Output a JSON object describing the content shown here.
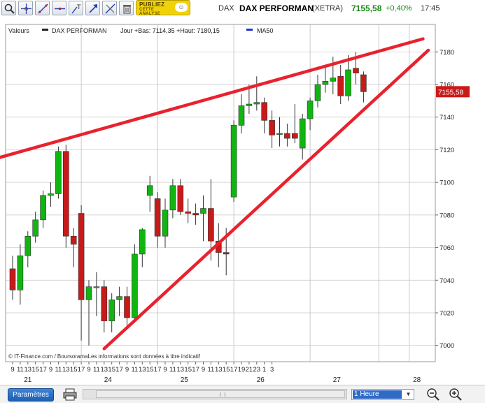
{
  "header": {
    "ad_line1": "PUBLIEZ",
    "ad_line2": "CETTE",
    "ad_line3": "ANALYSE",
    "ad_bubble": "☺",
    "ticker_prefix": "DAX",
    "ticker_name": "DAX PERFORMAN",
    "market": "(XETRA)",
    "price": "7155,58",
    "change": "+0,40%",
    "time": "17:45"
  },
  "toolbar_icons": [
    "zoom-icon",
    "crosshair-icon",
    "trendline-icon",
    "horizontal-line-icon",
    "text-icon",
    "arrow-icon",
    "erase-line-icon",
    "trash-icon"
  ],
  "legend": {
    "values_label": "Valeurs",
    "series_label": "DAX PERFORMAN",
    "stats": "Jour +Bas: 7114,35 +Haut: 7180,15",
    "ma_label": "MA50"
  },
  "footer_credit": "© IT-Finance.com / BoursoramaLes informations sont données à titre indicatif",
  "colors": {
    "up": "#11b511",
    "down": "#c91a1a",
    "trendline": "#e8222e",
    "grid": "#c8c8c8",
    "price_tag": "#c91a1a",
    "ma": "#1f34c9",
    "positive_text": "#1a8a1a"
  },
  "chart_data": {
    "type": "candlestick",
    "timeframe": "1 Heure",
    "ylim": [
      6995,
      7190
    ],
    "y_ticks": [
      7000,
      7020,
      7040,
      7060,
      7080,
      7100,
      7120,
      7140,
      7160,
      7180
    ],
    "x_hour_labels": [
      "9",
      "11",
      "13",
      "15",
      "17",
      "9",
      "11",
      "13",
      "15",
      "17",
      "9",
      "11",
      "13",
      "15",
      "17",
      "9",
      "11",
      "13",
      "15",
      "17",
      "9",
      "11",
      "13",
      "15",
      "17",
      "9",
      "11",
      "13",
      "15",
      "17",
      "19",
      "21",
      "23",
      "1",
      "3"
    ],
    "x_date_labels": [
      {
        "label": "21",
        "slot": 2
      },
      {
        "label": "24",
        "slot": 12.5
      },
      {
        "label": "25",
        "slot": 22.5
      },
      {
        "label": "26",
        "slot": 32.5
      },
      {
        "label": "27",
        "slot": 42.5
      },
      {
        "label": "28",
        "slot": 53
      }
    ],
    "day_separators": [
      9,
      19,
      29,
      39,
      48,
      52
    ],
    "last_price": 7155.58,
    "last_price_label": "7155,58",
    "candles": [
      {
        "slot": 0,
        "o": 7047,
        "h": 7055,
        "l": 7028,
        "c": 7034
      },
      {
        "slot": 1,
        "o": 7034,
        "h": 7062,
        "l": 7025,
        "c": 7055
      },
      {
        "slot": 2,
        "o": 7055,
        "h": 7070,
        "l": 7048,
        "c": 7067
      },
      {
        "slot": 3,
        "o": 7067,
        "h": 7082,
        "l": 7063,
        "c": 7077
      },
      {
        "slot": 4,
        "o": 7077,
        "h": 7095,
        "l": 7072,
        "c": 7092
      },
      {
        "slot": 5,
        "o": 7092,
        "h": 7100,
        "l": 7085,
        "c": 7093
      },
      {
        "slot": 6,
        "o": 7093,
        "h": 7122,
        "l": 7090,
        "c": 7119
      },
      {
        "slot": 7,
        "o": 7119,
        "h": 7123,
        "l": 7060,
        "c": 7067
      },
      {
        "slot": 8,
        "o": 7067,
        "h": 7072,
        "l": 7048,
        "c": 7062
      },
      {
        "slot": 9,
        "o": 7081,
        "h": 7086,
        "l": 7003,
        "c": 7028
      },
      {
        "slot": 10,
        "o": 7028,
        "h": 7040,
        "l": 7000,
        "c": 7036
      },
      {
        "slot": 11,
        "o": 7036,
        "h": 7045,
        "l": 7018,
        "c": 7036
      },
      {
        "slot": 12,
        "o": 7036,
        "h": 7040,
        "l": 7008,
        "c": 7015
      },
      {
        "slot": 13,
        "o": 7015,
        "h": 7032,
        "l": 7008,
        "c": 7028
      },
      {
        "slot": 14,
        "o": 7028,
        "h": 7036,
        "l": 7018,
        "c": 7030
      },
      {
        "slot": 15,
        "o": 7030,
        "h": 7036,
        "l": 7011,
        "c": 7017
      },
      {
        "slot": 16,
        "o": 7017,
        "h": 7062,
        "l": 7014,
        "c": 7056
      },
      {
        "slot": 17,
        "o": 7056,
        "h": 7072,
        "l": 7048,
        "c": 7071
      },
      {
        "slot": 18,
        "o": 7092,
        "h": 7104,
        "l": 7082,
        "c": 7098
      },
      {
        "slot": 19,
        "o": 7090,
        "h": 7094,
        "l": 7060,
        "c": 7067
      },
      {
        "slot": 20,
        "o": 7067,
        "h": 7090,
        "l": 7060,
        "c": 7083
      },
      {
        "slot": 21,
        "o": 7083,
        "h": 7102,
        "l": 7078,
        "c": 7098
      },
      {
        "slot": 22,
        "o": 7098,
        "h": 7102,
        "l": 7080,
        "c": 7082
      },
      {
        "slot": 23,
        "o": 7082,
        "h": 7090,
        "l": 7075,
        "c": 7081
      },
      {
        "slot": 24,
        "o": 7081,
        "h": 7087,
        "l": 7074,
        "c": 7080
      },
      {
        "slot": 25,
        "o": 7081,
        "h": 7092,
        "l": 7064,
        "c": 7084
      },
      {
        "slot": 26,
        "o": 7084,
        "h": 7102,
        "l": 7052,
        "c": 7064
      },
      {
        "slot": 27,
        "o": 7064,
        "h": 7075,
        "l": 7048,
        "c": 7057
      },
      {
        "slot": 28,
        "o": 7057,
        "h": 7072,
        "l": 7043,
        "c": 7056
      },
      {
        "slot": 29,
        "o": 7091,
        "h": 7138,
        "l": 7088,
        "c": 7135
      },
      {
        "slot": 30,
        "o": 7135,
        "h": 7154,
        "l": 7130,
        "c": 7147
      },
      {
        "slot": 31,
        "o": 7147,
        "h": 7160,
        "l": 7142,
        "c": 7148
      },
      {
        "slot": 32,
        "o": 7148,
        "h": 7165,
        "l": 7144,
        "c": 7149
      },
      {
        "slot": 33,
        "o": 7149,
        "h": 7152,
        "l": 7130,
        "c": 7138
      },
      {
        "slot": 34,
        "o": 7138,
        "h": 7144,
        "l": 7121,
        "c": 7129
      },
      {
        "slot": 35,
        "o": 7130,
        "h": 7140,
        "l": 7122,
        "c": 7130
      },
      {
        "slot": 36,
        "o": 7130,
        "h": 7136,
        "l": 7122,
        "c": 7127
      },
      {
        "slot": 37,
        "o": 7130,
        "h": 7148,
        "l": 7124,
        "c": 7127
      },
      {
        "slot": 38,
        "o": 7121,
        "h": 7142,
        "l": 7114,
        "c": 7139
      },
      {
        "slot": 39,
        "o": 7139,
        "h": 7152,
        "l": 7132,
        "c": 7150
      },
      {
        "slot": 40,
        "o": 7150,
        "h": 7166,
        "l": 7146,
        "c": 7160
      },
      {
        "slot": 41,
        "o": 7160,
        "h": 7172,
        "l": 7155,
        "c": 7162
      },
      {
        "slot": 42,
        "o": 7162,
        "h": 7177,
        "l": 7154,
        "c": 7164
      },
      {
        "slot": 43,
        "o": 7165,
        "h": 7172,
        "l": 7148,
        "c": 7153
      },
      {
        "slot": 44,
        "o": 7153,
        "h": 7178,
        "l": 7150,
        "c": 7169
      },
      {
        "slot": 45,
        "o": 7170,
        "h": 7180,
        "l": 7160,
        "c": 7167
      },
      {
        "slot": 46,
        "o": 7166,
        "h": 7168,
        "l": 7149,
        "c": 7155.58
      }
    ],
    "trendlines": [
      {
        "name": "upper",
        "from": {
          "slot": -5.7,
          "value": 7110
        },
        "to": {
          "slot": 53.8,
          "value": 7188
        }
      },
      {
        "name": "lower",
        "from": {
          "slot": 12,
          "value": 6998
        },
        "to": {
          "slot": 54.5,
          "value": 7181
        }
      }
    ]
  },
  "footer": {
    "params_label": "Paramètres",
    "timeframe": "1 Heure"
  }
}
